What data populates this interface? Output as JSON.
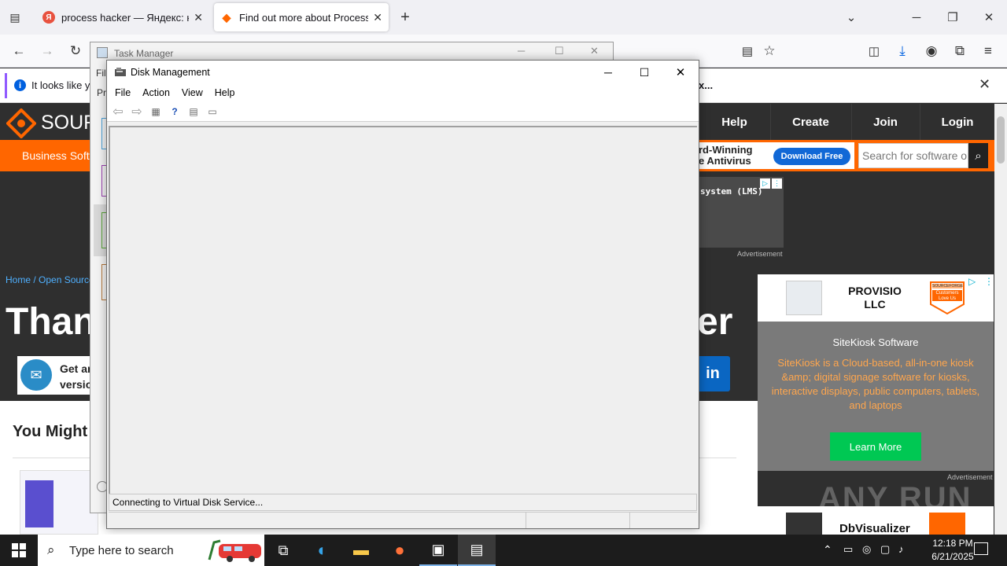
{
  "browser": {
    "tabs": [
      {
        "title": "process hacker — Яндекс: наш",
        "favicon": "Я",
        "active": false
      },
      {
        "title": "Find out more about Process Ha",
        "favicon": "◆",
        "active": true
      }
    ],
    "infobar_text": "It looks like yo",
    "infobar_link": "x..."
  },
  "site": {
    "logo_text": "SOUR",
    "nav": [
      "Help",
      "Create",
      "Join",
      "Login"
    ],
    "business_text": "Business Softw",
    "ad_banner_text": "rd-Winning\ne Antivirus",
    "download_btn": "Download Free",
    "search_placeholder": "Search for software or",
    "ad_lms": "system (LMS)",
    "advertisement": "Advertisement",
    "breadcrumb": "Home / Open Source",
    "big_title_left": "Than",
    "big_title_right": "er",
    "get_text": "Get ar\nversio",
    "you_might": "You Might A",
    "provisio": "PROVISIO\nLLC",
    "sitekiosk_title": "SiteKiosk Software",
    "sitekiosk_desc": "SiteKiosk is a Cloud-based, all-in-one kiosk &amp; digital signage software for kiosks, interactive displays, public computers, tablets, and laptops",
    "learn_more": "Learn More",
    "dbvisualizer": "DbVisualizer",
    "badge": "Customers Love Us",
    "badge_top": "SOURCEFORGE",
    "watermark": "ANY RUN"
  },
  "task_manager": {
    "title": "Task Manager",
    "menu_fragment_1": "Fil",
    "menu_fragment_2": "Pr"
  },
  "disk_management": {
    "title": "Disk Management",
    "menu": [
      "File",
      "Action",
      "View",
      "Help"
    ],
    "status": "Connecting to Virtual Disk Service..."
  },
  "taskbar": {
    "search_placeholder": "Type here to search",
    "time": "12:18 PM",
    "date": "6/21/2025"
  }
}
